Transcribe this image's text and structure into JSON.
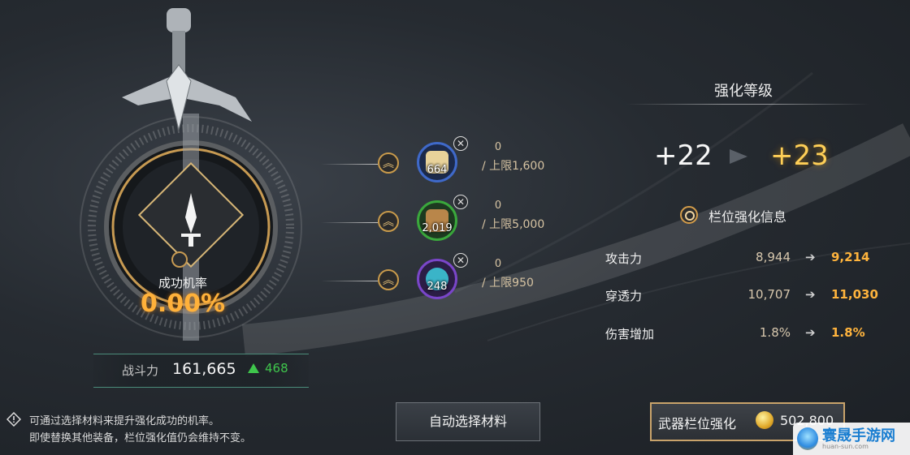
{
  "success_rate": {
    "label": "成功机率",
    "value": "0.00%"
  },
  "combat_power": {
    "label": "战斗力",
    "value": "161,665",
    "delta": "468",
    "delta_icon": "triangle-up-icon",
    "delta_color": "#3fc64c"
  },
  "materials": [
    {
      "count": "664",
      "current": "0",
      "max": "/ 上限1,600",
      "ring_color": "#3f69c9",
      "inner_color": "#e8d29a"
    },
    {
      "count": "2,019",
      "current": "0",
      "max": "/ 上限5,000",
      "ring_color": "#3aa83c",
      "inner_color": "#b9864a"
    },
    {
      "count": "248",
      "current": "0",
      "max": "/ 上限950",
      "ring_color": "#7a46c9",
      "inner_color": "#3ab4c8"
    }
  ],
  "enhance": {
    "title": "强化等级",
    "current_level": "+22",
    "next_level": "+23",
    "info_label": "栏位强化信息",
    "stats": [
      {
        "name": "攻击力",
        "current": "8,944",
        "next": "9,214"
      },
      {
        "name": "穿透力",
        "current": "10,707",
        "next": "11,030"
      },
      {
        "name": "伤害增加",
        "current": "1.8%",
        "next": "1.8%"
      }
    ]
  },
  "hints": {
    "line1": "可通过选择材料来提升强化成功的机率。",
    "line2": "即使替换其他装备，栏位强化值仍会维持不变。"
  },
  "buttons": {
    "auto_select": "自动选择材料",
    "upgrade_label": "武器栏位强化",
    "upgrade_cost": "502,800"
  },
  "watermark": {
    "text": "寰晟手游网",
    "url": "huan-sun.com"
  },
  "colors": {
    "accent_gold": "#ffb13a",
    "next_value": "#ffb43d"
  }
}
